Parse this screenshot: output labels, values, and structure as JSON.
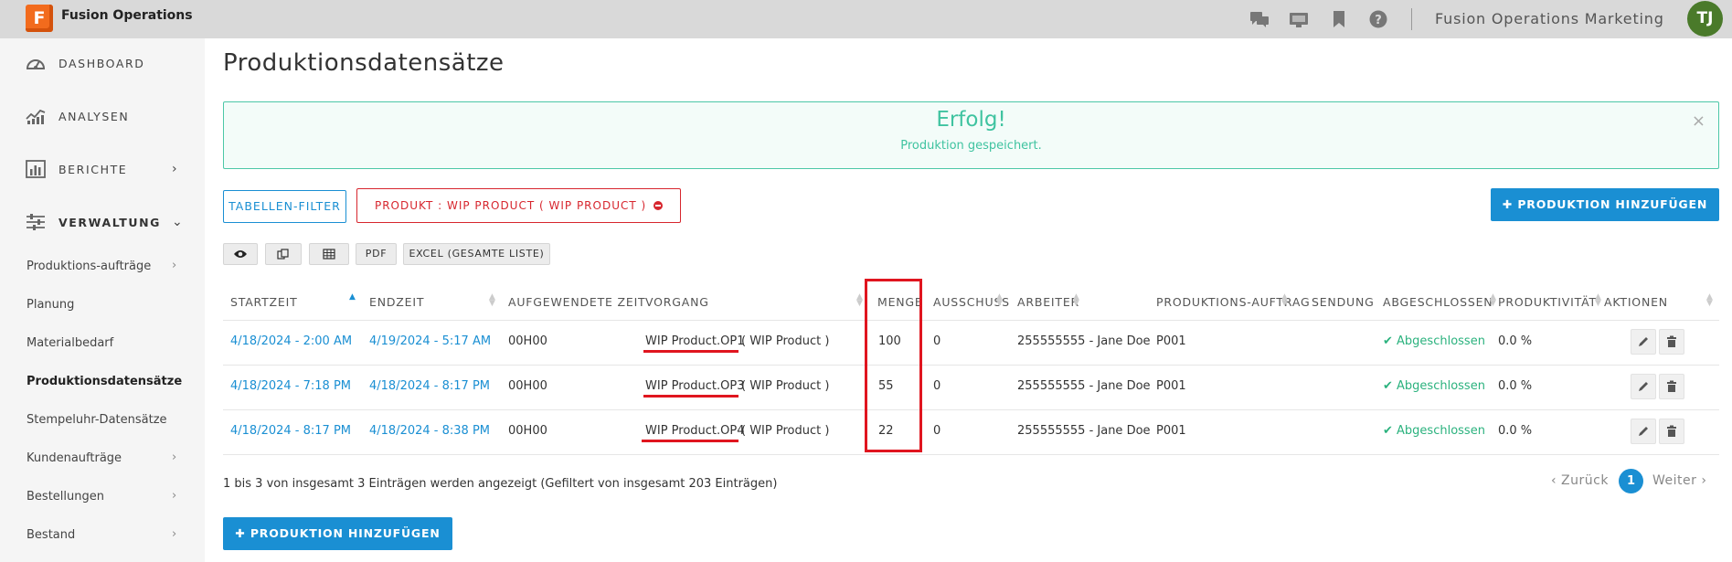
{
  "app": {
    "logo_letter": "F",
    "title": "Fusion Operations",
    "org_name": "Fusion Operations Marketing",
    "user_initials": "TJ"
  },
  "sidebar": {
    "main": [
      {
        "label": "DASHBOARD",
        "icon": "speedometer-icon"
      },
      {
        "label": "ANALYSEN",
        "icon": "analytics-chart-icon"
      },
      {
        "label": "BERICHTE",
        "icon": "bar-chart-icon"
      },
      {
        "label": "VERWALTUNG",
        "icon": "sliders-icon"
      }
    ],
    "sub": [
      {
        "label": "Produktions-aufträge"
      },
      {
        "label": "Planung"
      },
      {
        "label": "Materialbedarf"
      },
      {
        "label": "Produktionsdatensätze"
      },
      {
        "label": "Stempeluhr-Datensätze"
      },
      {
        "label": "Kundenaufträge"
      },
      {
        "label": "Bestellungen"
      },
      {
        "label": "Bestand"
      }
    ]
  },
  "page": {
    "title": "Produktionsdatensätze"
  },
  "alert": {
    "title": "Erfolg!",
    "message": "Produktion gespeichert.",
    "close": "×"
  },
  "toolbar": {
    "filter_label": "TABELLEN-FILTER",
    "product_chip": "PRODUKT : WIP PRODUCT ( WIP PRODUCT )",
    "add_label": "✚ PRODUKTION HINZUFÜGEN",
    "pdf_label": "PDF",
    "excel_label": "EXCEL (GESAMTE LISTE)"
  },
  "table": {
    "headers": {
      "start": "STARTZEIT",
      "end": "ENDZEIT",
      "spent": "AUFGEWENDETE ZEIT",
      "op": "VORGANG",
      "qty": "MENGE",
      "scrap": "AUSSCHUSS",
      "worker": "ARBEITER",
      "order": "PRODUKTIONS-AUFTRAG",
      "shipment": "SENDUNG",
      "completed": "ABGESCHLOSSEN",
      "productivity": "PRODUKTIVITÄT",
      "actions": "AKTIONEN"
    },
    "rows": [
      {
        "start": "4/18/2024 - 2:00 AM",
        "end": "4/19/2024 - 5:17 AM",
        "spent": "00H00",
        "op_name": "WIP Product.OP1",
        "op_product": "( WIP Product )",
        "qty": "100",
        "scrap": "0",
        "worker": "255555555 - Jane Doe",
        "order": "P001",
        "shipment": "",
        "status": "✔ Abgeschlossen",
        "productivity": "0.0 %"
      },
      {
        "start": "4/18/2024 - 7:18 PM",
        "end": "4/18/2024 - 8:17 PM",
        "spent": "00H00",
        "op_name": "WIP Product.OP3",
        "op_product": "( WIP Product )",
        "qty": "55",
        "scrap": "0",
        "worker": "255555555 - Jane Doe",
        "order": "P001",
        "shipment": "",
        "status": "✔ Abgeschlossen",
        "productivity": "0.0 %"
      },
      {
        "start": "4/18/2024 - 8:17 PM",
        "end": "4/18/2024 - 8:38 PM",
        "spent": "00H00",
        "op_name": "WIP Product.OP4",
        "op_product": "( WIP Product )",
        "qty": "22",
        "scrap": "0",
        "worker": "255555555 - Jane Doe",
        "order": "P001",
        "shipment": "",
        "status": "✔ Abgeschlossen",
        "productivity": "0.0 %"
      }
    ]
  },
  "footer": {
    "info": "1 bis 3 von insgesamt 3 Einträgen werden angezeigt (Gefiltert von insgesamt 203 Einträgen)",
    "prev": "‹ Zurück",
    "page": "1",
    "next": "Weiter ›"
  },
  "colors": {
    "accent": "#1a8fd3",
    "success": "#3fc3a0",
    "danger": "#d7262e",
    "highlight": "#e0151f"
  }
}
